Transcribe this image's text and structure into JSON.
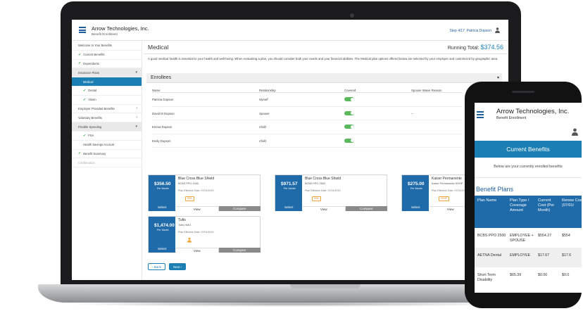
{
  "laptop": {
    "header": {
      "brand": "Arrow Technologies, Inc.",
      "sub": "Benefit Enrollment",
      "step": "Step 4/17",
      "user": "Patricia Dopson"
    },
    "sidebar": [
      {
        "label": "Welcome to Your Benefits",
        "check": false,
        "type": "item"
      },
      {
        "label": "Current Benefits",
        "check": true,
        "type": "item"
      },
      {
        "label": "Dependents",
        "check": true,
        "type": "item"
      },
      {
        "label": "Insurance Plans",
        "check": false,
        "type": "group",
        "arrow": "down"
      },
      {
        "label": "Medical",
        "check": false,
        "type": "active"
      },
      {
        "label": "Dental",
        "check": true,
        "type": "sub"
      },
      {
        "label": "Vision",
        "check": true,
        "type": "sub"
      },
      {
        "label": "Employer Provided Benefits",
        "check": false,
        "type": "item",
        "arrow": "right"
      },
      {
        "label": "Voluntary Benefits",
        "check": false,
        "type": "item",
        "arrow": "right"
      },
      {
        "label": "Flexible Spending",
        "check": false,
        "type": "group",
        "arrow": "down"
      },
      {
        "label": "FSA",
        "check": true,
        "type": "sub"
      },
      {
        "label": "Health Savings Account",
        "check": false,
        "type": "sub"
      },
      {
        "label": "Benefit Summary",
        "check": true,
        "type": "item"
      },
      {
        "label": "Confirmation",
        "check": false,
        "type": "muted"
      }
    ],
    "main": {
      "title": "Medical",
      "running_label": "Running Total:",
      "running_amount": "$374.56",
      "intro": "A good medical health is essential to your health and well-being. When evaluating a plan, you should consider both your needs and your financial abilities. The Medical plan options offered below are selected by your employer and customized by geographic area.",
      "enrollees_title": "Enrollees",
      "enrollees_caret": "▾",
      "columns": [
        "Name",
        "Relationship",
        "Covered",
        "Spouse Waive Reason"
      ],
      "enrollees": [
        {
          "name": "Patricia Dopson",
          "relationship": "Myself",
          "spouse": ""
        },
        {
          "name": "David M Dopson",
          "relationship": "Spouse",
          "spouse": "–"
        },
        {
          "name": "Emma Dopson",
          "relationship": "Child",
          "spouse": ""
        },
        {
          "name": "Emily Dopson",
          "relationship": "Child",
          "spouse": ""
        }
      ],
      "plans": [
        {
          "price": "$356.50",
          "per": "Per Month",
          "select": "Select",
          "name": "Blue Cross Blue Shield",
          "type": "BCBS PPO 1000",
          "date": "Plan Effective Date: 07/01/2019",
          "badge": "HSA",
          "view": "View",
          "compare": "Compare"
        },
        {
          "price": "$971.57",
          "per": "Per Month",
          "select": "Select",
          "name": "Blue Cross Blue Shield",
          "type": "BCBS PPO 2500",
          "date": "Plan Effective Date: 07/01/2019",
          "badge": "HSA",
          "view": "View",
          "compare": "Compare"
        },
        {
          "price": "$275.00",
          "per": "Per Month",
          "select": "Select",
          "name": "Kaiser Permanente",
          "type": "Kaiser Permanente HDHP",
          "date": "Plan Effective Date: 07/01/2019",
          "badge": "HDHP",
          "view": "View",
          "compare": ""
        },
        {
          "price": "$1,474.00",
          "per": "Per Month",
          "select": "Select",
          "name": "Tufts",
          "type": "Tufts HMO",
          "date": "Plan Effective Date: 07/01/2019",
          "badge": "",
          "view": "View",
          "compare": "Compare"
        }
      ],
      "back": "‹  Back",
      "next": "Next  ›"
    }
  },
  "phone": {
    "brand": "Arrow Technologies, Inc.",
    "sub": "Benefit Enrollment",
    "banner": "Current Benefits",
    "enrolled_text": "Below are your currently enrolled benefits",
    "plans_title": "Benefit Plans",
    "headers": [
      "Plan Name",
      "Plan Type / Coverage Amount",
      "Current Cost (Per Month)",
      "Renew Cost (07/01/"
    ],
    "rows": [
      {
        "name": "BCBS PPO 2500",
        "type": "EMPLOYEE + SPOUSE",
        "cost": "$554.27",
        "renew": "$554"
      },
      {
        "name": "AETNA Dental",
        "type": "EMPLOYEE",
        "cost": "$17.67",
        "renew": "$17.6"
      },
      {
        "name": "Short Term Disability",
        "type": "$65.39",
        "cost": "$0.00",
        "renew": "$0.0"
      }
    ]
  },
  "colors": {
    "primary": "#1c7fb3",
    "card_blue": "#1f6aa8",
    "check": "#3aa94a",
    "toggle": "#5cb85c",
    "badge": "#f0a640"
  }
}
